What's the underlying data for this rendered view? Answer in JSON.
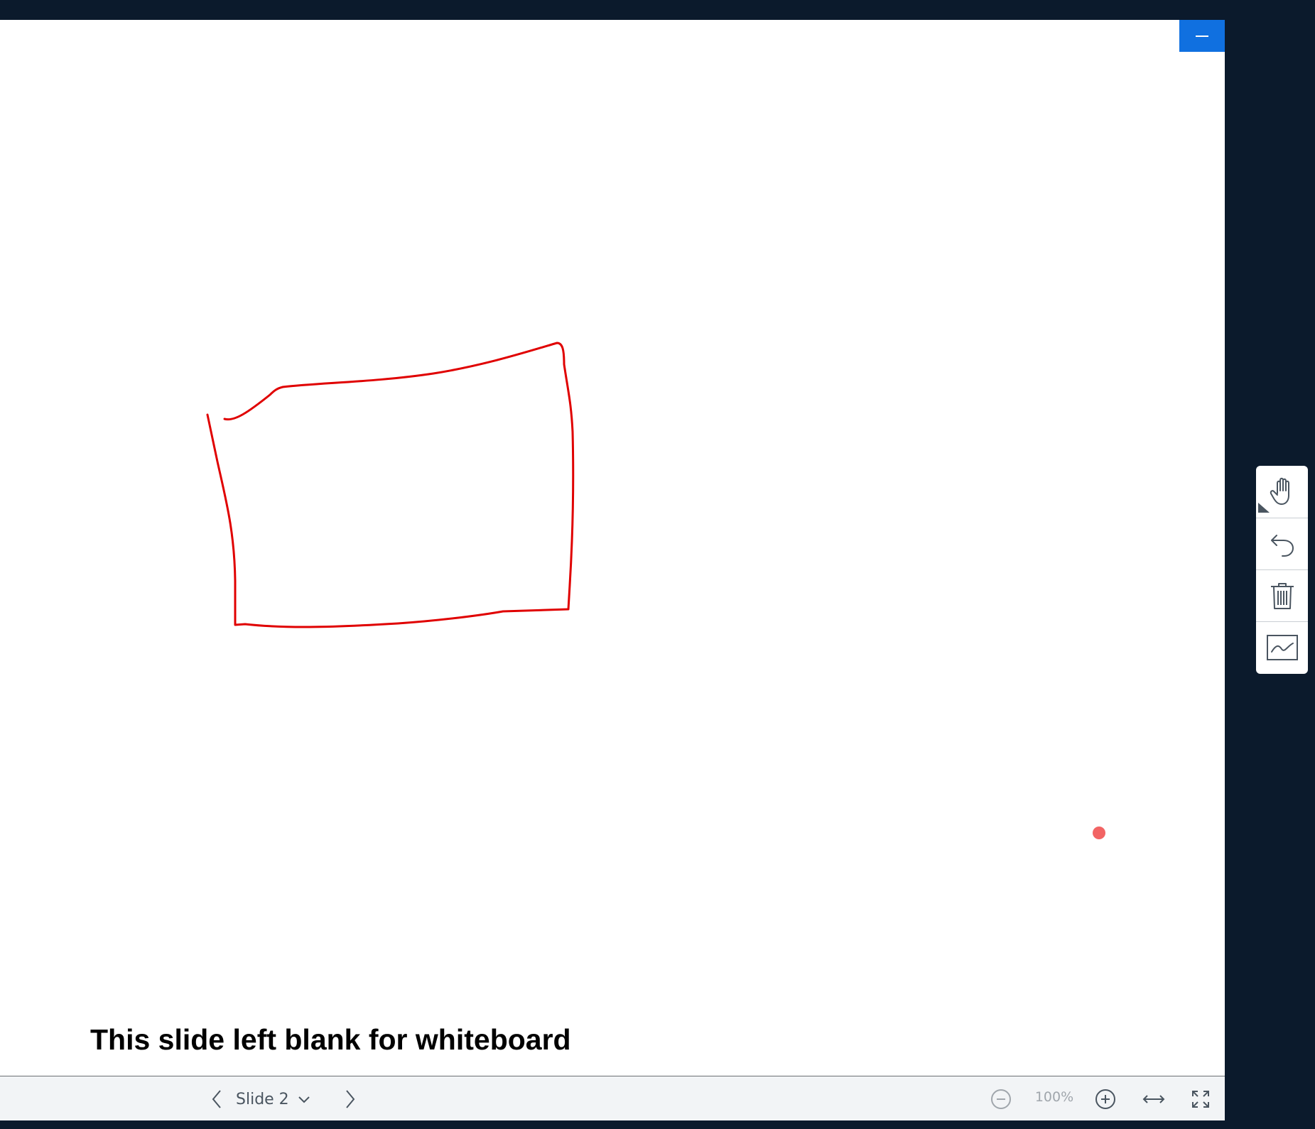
{
  "presentation": {
    "caption": "This slide left blank for whiteboard",
    "annotation_color": "#e00000",
    "pointer_color": "#f26464"
  },
  "header": {
    "minimize_icon": "minus-icon"
  },
  "navigation": {
    "prev_icon": "chevron-left-icon",
    "next_icon": "chevron-right-icon",
    "slide_label": "Slide 2",
    "dropdown_icon": "chevron-down-icon"
  },
  "zoom": {
    "zoom_out_icon": "minus-circle-icon",
    "value": "100%",
    "zoom_in_icon": "plus-circle-icon",
    "fit_width_icon": "arrows-horizontal-icon",
    "fullscreen_icon": "expand-icon"
  },
  "tools": [
    {
      "name": "hand-tool",
      "icon": "hand-icon"
    },
    {
      "name": "undo-tool",
      "icon": "undo-icon"
    },
    {
      "name": "clear-all-tool",
      "icon": "trash-icon"
    },
    {
      "name": "multi-user-tool",
      "icon": "whiteboard-icon"
    }
  ],
  "colors": {
    "background": "#0b1a2c",
    "accent": "#1070e0",
    "bar": "#f2f4f6"
  }
}
